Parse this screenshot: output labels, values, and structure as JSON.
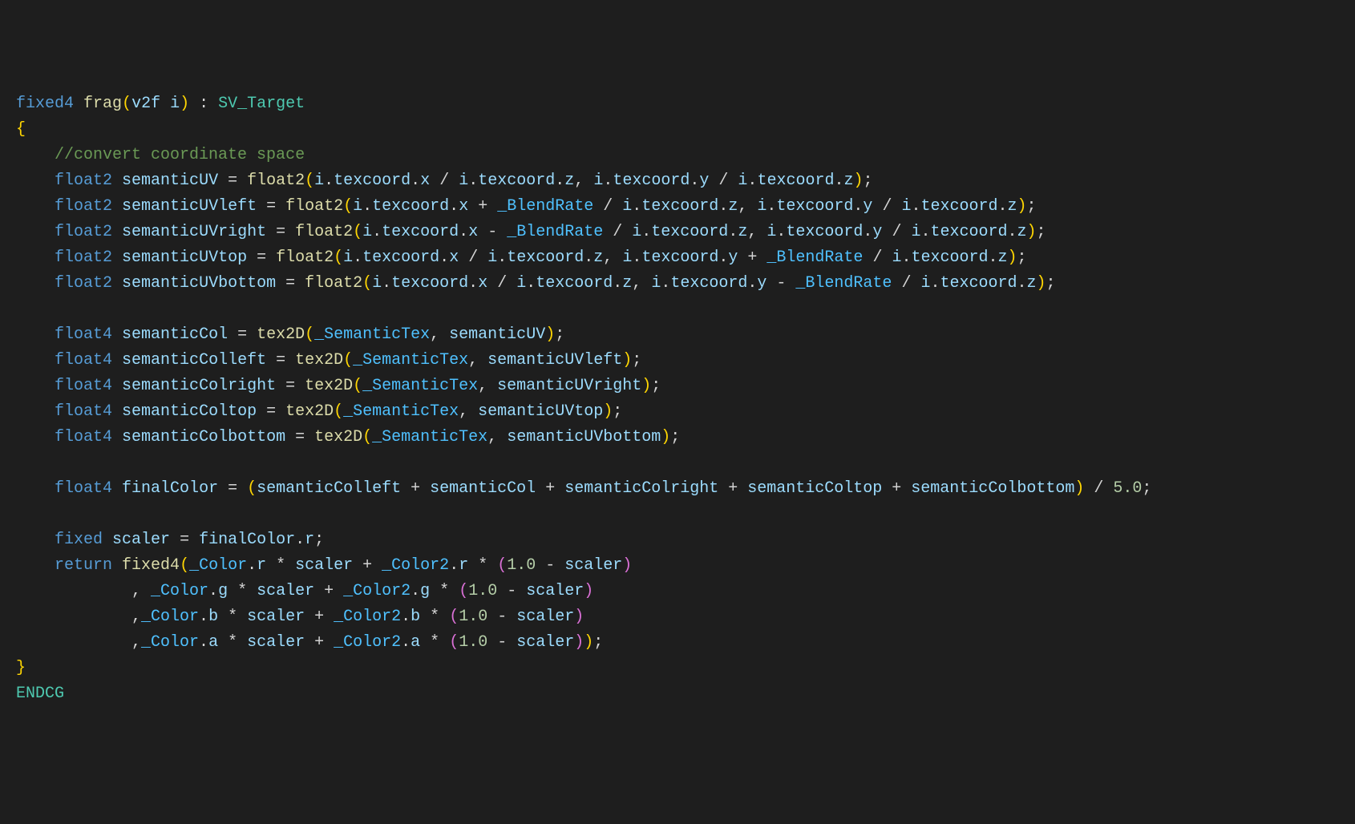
{
  "tokens": [
    [
      [
        "kw",
        "fixed4"
      ],
      [
        "pnc",
        " "
      ],
      [
        "fn",
        "frag"
      ],
      [
        "brk",
        "("
      ],
      [
        "id",
        "v2f"
      ],
      [
        "pnc",
        " "
      ],
      [
        "id",
        "i"
      ],
      [
        "brk",
        ")"
      ],
      [
        "pnc",
        " : "
      ],
      [
        "str",
        "SV_Target"
      ]
    ],
    [
      [
        "brk",
        "{"
      ]
    ],
    [
      [
        "pnc",
        "    "
      ],
      [
        "cmt",
        "//convert coordinate space"
      ]
    ],
    [
      [
        "pnc",
        "    "
      ],
      [
        "kw",
        "float2"
      ],
      [
        "pnc",
        " "
      ],
      [
        "id",
        "semanticUV"
      ],
      [
        "pnc",
        " = "
      ],
      [
        "fn",
        "float2"
      ],
      [
        "brk",
        "("
      ],
      [
        "id",
        "i"
      ],
      [
        "pnc",
        "."
      ],
      [
        "id",
        "texcoord"
      ],
      [
        "pnc",
        "."
      ],
      [
        "id",
        "x"
      ],
      [
        "pnc",
        " / "
      ],
      [
        "id",
        "i"
      ],
      [
        "pnc",
        "."
      ],
      [
        "id",
        "texcoord"
      ],
      [
        "pnc",
        "."
      ],
      [
        "id",
        "z"
      ],
      [
        "pnc",
        ", "
      ],
      [
        "id",
        "i"
      ],
      [
        "pnc",
        "."
      ],
      [
        "id",
        "texcoord"
      ],
      [
        "pnc",
        "."
      ],
      [
        "id",
        "y"
      ],
      [
        "pnc",
        " / "
      ],
      [
        "id",
        "i"
      ],
      [
        "pnc",
        "."
      ],
      [
        "id",
        "texcoord"
      ],
      [
        "pnc",
        "."
      ],
      [
        "id",
        "z"
      ],
      [
        "brk",
        ")"
      ],
      [
        "pnc",
        ";"
      ]
    ],
    [
      [
        "pnc",
        "    "
      ],
      [
        "kw",
        "float2"
      ],
      [
        "pnc",
        " "
      ],
      [
        "id",
        "semanticUVleft"
      ],
      [
        "pnc",
        " = "
      ],
      [
        "fn",
        "float2"
      ],
      [
        "brk",
        "("
      ],
      [
        "id",
        "i"
      ],
      [
        "pnc",
        "."
      ],
      [
        "id",
        "texcoord"
      ],
      [
        "pnc",
        "."
      ],
      [
        "id",
        "x"
      ],
      [
        "pnc",
        " + "
      ],
      [
        "enm",
        "_BlendRate"
      ],
      [
        "pnc",
        " / "
      ],
      [
        "id",
        "i"
      ],
      [
        "pnc",
        "."
      ],
      [
        "id",
        "texcoord"
      ],
      [
        "pnc",
        "."
      ],
      [
        "id",
        "z"
      ],
      [
        "pnc",
        ", "
      ],
      [
        "id",
        "i"
      ],
      [
        "pnc",
        "."
      ],
      [
        "id",
        "texcoord"
      ],
      [
        "pnc",
        "."
      ],
      [
        "id",
        "y"
      ],
      [
        "pnc",
        " / "
      ],
      [
        "id",
        "i"
      ],
      [
        "pnc",
        "."
      ],
      [
        "id",
        "texcoord"
      ],
      [
        "pnc",
        "."
      ],
      [
        "id",
        "z"
      ],
      [
        "brk",
        ")"
      ],
      [
        "pnc",
        ";"
      ]
    ],
    [
      [
        "pnc",
        "    "
      ],
      [
        "kw",
        "float2"
      ],
      [
        "pnc",
        " "
      ],
      [
        "id",
        "semanticUVright"
      ],
      [
        "pnc",
        " = "
      ],
      [
        "fn",
        "float2"
      ],
      [
        "brk",
        "("
      ],
      [
        "id",
        "i"
      ],
      [
        "pnc",
        "."
      ],
      [
        "id",
        "texcoord"
      ],
      [
        "pnc",
        "."
      ],
      [
        "id",
        "x"
      ],
      [
        "pnc",
        " - "
      ],
      [
        "enm",
        "_BlendRate"
      ],
      [
        "pnc",
        " / "
      ],
      [
        "id",
        "i"
      ],
      [
        "pnc",
        "."
      ],
      [
        "id",
        "texcoord"
      ],
      [
        "pnc",
        "."
      ],
      [
        "id",
        "z"
      ],
      [
        "pnc",
        ", "
      ],
      [
        "id",
        "i"
      ],
      [
        "pnc",
        "."
      ],
      [
        "id",
        "texcoord"
      ],
      [
        "pnc",
        "."
      ],
      [
        "id",
        "y"
      ],
      [
        "pnc",
        " / "
      ],
      [
        "id",
        "i"
      ],
      [
        "pnc",
        "."
      ],
      [
        "id",
        "texcoord"
      ],
      [
        "pnc",
        "."
      ],
      [
        "id",
        "z"
      ],
      [
        "brk",
        ")"
      ],
      [
        "pnc",
        ";"
      ]
    ],
    [
      [
        "pnc",
        "    "
      ],
      [
        "kw",
        "float2"
      ],
      [
        "pnc",
        " "
      ],
      [
        "id",
        "semanticUVtop"
      ],
      [
        "pnc",
        " = "
      ],
      [
        "fn",
        "float2"
      ],
      [
        "brk",
        "("
      ],
      [
        "id",
        "i"
      ],
      [
        "pnc",
        "."
      ],
      [
        "id",
        "texcoord"
      ],
      [
        "pnc",
        "."
      ],
      [
        "id",
        "x"
      ],
      [
        "pnc",
        " / "
      ],
      [
        "id",
        "i"
      ],
      [
        "pnc",
        "."
      ],
      [
        "id",
        "texcoord"
      ],
      [
        "pnc",
        "."
      ],
      [
        "id",
        "z"
      ],
      [
        "pnc",
        ", "
      ],
      [
        "id",
        "i"
      ],
      [
        "pnc",
        "."
      ],
      [
        "id",
        "texcoord"
      ],
      [
        "pnc",
        "."
      ],
      [
        "id",
        "y"
      ],
      [
        "pnc",
        " + "
      ],
      [
        "enm",
        "_BlendRate"
      ],
      [
        "pnc",
        " / "
      ],
      [
        "id",
        "i"
      ],
      [
        "pnc",
        "."
      ],
      [
        "id",
        "texcoord"
      ],
      [
        "pnc",
        "."
      ],
      [
        "id",
        "z"
      ],
      [
        "brk",
        ")"
      ],
      [
        "pnc",
        ";"
      ]
    ],
    [
      [
        "pnc",
        "    "
      ],
      [
        "kw",
        "float2"
      ],
      [
        "pnc",
        " "
      ],
      [
        "id",
        "semanticUVbottom"
      ],
      [
        "pnc",
        " = "
      ],
      [
        "fn",
        "float2"
      ],
      [
        "brk",
        "("
      ],
      [
        "id",
        "i"
      ],
      [
        "pnc",
        "."
      ],
      [
        "id",
        "texcoord"
      ],
      [
        "pnc",
        "."
      ],
      [
        "id",
        "x"
      ],
      [
        "pnc",
        " / "
      ],
      [
        "id",
        "i"
      ],
      [
        "pnc",
        "."
      ],
      [
        "id",
        "texcoord"
      ],
      [
        "pnc",
        "."
      ],
      [
        "id",
        "z"
      ],
      [
        "pnc",
        ", "
      ],
      [
        "id",
        "i"
      ],
      [
        "pnc",
        "."
      ],
      [
        "id",
        "texcoord"
      ],
      [
        "pnc",
        "."
      ],
      [
        "id",
        "y"
      ],
      [
        "pnc",
        " - "
      ],
      [
        "enm",
        "_BlendRate"
      ],
      [
        "pnc",
        " / "
      ],
      [
        "id",
        "i"
      ],
      [
        "pnc",
        "."
      ],
      [
        "id",
        "texcoord"
      ],
      [
        "pnc",
        "."
      ],
      [
        "id",
        "z"
      ],
      [
        "brk",
        ")"
      ],
      [
        "pnc",
        ";"
      ]
    ],
    [
      [
        "pnc",
        ""
      ]
    ],
    [
      [
        "pnc",
        "    "
      ],
      [
        "kw",
        "float4"
      ],
      [
        "pnc",
        " "
      ],
      [
        "id",
        "semanticCol"
      ],
      [
        "pnc",
        " = "
      ],
      [
        "fn",
        "tex2D"
      ],
      [
        "brk",
        "("
      ],
      [
        "enm",
        "_SemanticTex"
      ],
      [
        "pnc",
        ", "
      ],
      [
        "id",
        "semanticUV"
      ],
      [
        "brk",
        ")"
      ],
      [
        "pnc",
        ";"
      ]
    ],
    [
      [
        "pnc",
        "    "
      ],
      [
        "kw",
        "float4"
      ],
      [
        "pnc",
        " "
      ],
      [
        "id",
        "semanticColleft"
      ],
      [
        "pnc",
        " = "
      ],
      [
        "fn",
        "tex2D"
      ],
      [
        "brk",
        "("
      ],
      [
        "enm",
        "_SemanticTex"
      ],
      [
        "pnc",
        ", "
      ],
      [
        "id",
        "semanticUVleft"
      ],
      [
        "brk",
        ")"
      ],
      [
        "pnc",
        ";"
      ]
    ],
    [
      [
        "pnc",
        "    "
      ],
      [
        "kw",
        "float4"
      ],
      [
        "pnc",
        " "
      ],
      [
        "id",
        "semanticColright"
      ],
      [
        "pnc",
        " = "
      ],
      [
        "fn",
        "tex2D"
      ],
      [
        "brk",
        "("
      ],
      [
        "enm",
        "_SemanticTex"
      ],
      [
        "pnc",
        ", "
      ],
      [
        "id",
        "semanticUVright"
      ],
      [
        "brk",
        ")"
      ],
      [
        "pnc",
        ";"
      ]
    ],
    [
      [
        "pnc",
        "    "
      ],
      [
        "kw",
        "float4"
      ],
      [
        "pnc",
        " "
      ],
      [
        "id",
        "semanticColtop"
      ],
      [
        "pnc",
        " = "
      ],
      [
        "fn",
        "tex2D"
      ],
      [
        "brk",
        "("
      ],
      [
        "enm",
        "_SemanticTex"
      ],
      [
        "pnc",
        ", "
      ],
      [
        "id",
        "semanticUVtop"
      ],
      [
        "brk",
        ")"
      ],
      [
        "pnc",
        ";"
      ]
    ],
    [
      [
        "pnc",
        "    "
      ],
      [
        "kw",
        "float4"
      ],
      [
        "pnc",
        " "
      ],
      [
        "id",
        "semanticColbottom"
      ],
      [
        "pnc",
        " = "
      ],
      [
        "fn",
        "tex2D"
      ],
      [
        "brk",
        "("
      ],
      [
        "enm",
        "_SemanticTex"
      ],
      [
        "pnc",
        ", "
      ],
      [
        "id",
        "semanticUVbottom"
      ],
      [
        "brk",
        ")"
      ],
      [
        "pnc",
        ";"
      ]
    ],
    [
      [
        "pnc",
        ""
      ]
    ],
    [
      [
        "pnc",
        "    "
      ],
      [
        "kw",
        "float4"
      ],
      [
        "pnc",
        " "
      ],
      [
        "id",
        "finalColor"
      ],
      [
        "pnc",
        " = "
      ],
      [
        "brk",
        "("
      ],
      [
        "id",
        "semanticColleft"
      ],
      [
        "pnc",
        " + "
      ],
      [
        "id",
        "semanticCol"
      ],
      [
        "pnc",
        " + "
      ],
      [
        "id",
        "semanticColright"
      ],
      [
        "pnc",
        " + "
      ],
      [
        "id",
        "semanticColtop"
      ],
      [
        "pnc",
        " + "
      ],
      [
        "id",
        "semanticColbottom"
      ],
      [
        "brk",
        ")"
      ],
      [
        "pnc",
        " / "
      ],
      [
        "num",
        "5.0"
      ],
      [
        "pnc",
        ";"
      ]
    ],
    [
      [
        "pnc",
        ""
      ]
    ],
    [
      [
        "pnc",
        "    "
      ],
      [
        "kw",
        "fixed"
      ],
      [
        "pnc",
        " "
      ],
      [
        "id",
        "scaler"
      ],
      [
        "pnc",
        " = "
      ],
      [
        "id",
        "finalColor"
      ],
      [
        "pnc",
        "."
      ],
      [
        "id",
        "r"
      ],
      [
        "pnc",
        ";"
      ]
    ],
    [
      [
        "pnc",
        "    "
      ],
      [
        "kw",
        "return"
      ],
      [
        "pnc",
        " "
      ],
      [
        "fn",
        "fixed4"
      ],
      [
        "brk",
        "("
      ],
      [
        "enm",
        "_Color"
      ],
      [
        "pnc",
        "."
      ],
      [
        "id",
        "r"
      ],
      [
        "pnc",
        " * "
      ],
      [
        "id",
        "scaler"
      ],
      [
        "pnc",
        " + "
      ],
      [
        "enm",
        "_Color2"
      ],
      [
        "pnc",
        "."
      ],
      [
        "id",
        "r"
      ],
      [
        "pnc",
        " * "
      ],
      [
        "pk",
        "("
      ],
      [
        "num",
        "1.0"
      ],
      [
        "pnc",
        " - "
      ],
      [
        "id",
        "scaler"
      ],
      [
        "pk",
        ")"
      ]
    ],
    [
      [
        "pnc",
        "            , "
      ],
      [
        "enm",
        "_Color"
      ],
      [
        "pnc",
        "."
      ],
      [
        "id",
        "g"
      ],
      [
        "pnc",
        " * "
      ],
      [
        "id",
        "scaler"
      ],
      [
        "pnc",
        " + "
      ],
      [
        "enm",
        "_Color2"
      ],
      [
        "pnc",
        "."
      ],
      [
        "id",
        "g"
      ],
      [
        "pnc",
        " * "
      ],
      [
        "pk",
        "("
      ],
      [
        "num",
        "1.0"
      ],
      [
        "pnc",
        " - "
      ],
      [
        "id",
        "scaler"
      ],
      [
        "pk",
        ")"
      ]
    ],
    [
      [
        "pnc",
        "            ,"
      ],
      [
        "enm",
        "_Color"
      ],
      [
        "pnc",
        "."
      ],
      [
        "id",
        "b"
      ],
      [
        "pnc",
        " * "
      ],
      [
        "id",
        "scaler"
      ],
      [
        "pnc",
        " + "
      ],
      [
        "enm",
        "_Color2"
      ],
      [
        "pnc",
        "."
      ],
      [
        "id",
        "b"
      ],
      [
        "pnc",
        " * "
      ],
      [
        "pk",
        "("
      ],
      [
        "num",
        "1.0"
      ],
      [
        "pnc",
        " - "
      ],
      [
        "id",
        "scaler"
      ],
      [
        "pk",
        ")"
      ]
    ],
    [
      [
        "pnc",
        "            ,"
      ],
      [
        "enm",
        "_Color"
      ],
      [
        "pnc",
        "."
      ],
      [
        "id",
        "a"
      ],
      [
        "pnc",
        " * "
      ],
      [
        "id",
        "scaler"
      ],
      [
        "pnc",
        " + "
      ],
      [
        "enm",
        "_Color2"
      ],
      [
        "pnc",
        "."
      ],
      [
        "id",
        "a"
      ],
      [
        "pnc",
        " * "
      ],
      [
        "pk",
        "("
      ],
      [
        "num",
        "1.0"
      ],
      [
        "pnc",
        " - "
      ],
      [
        "id",
        "scaler"
      ],
      [
        "pk",
        ")"
      ],
      [
        "brk",
        ")"
      ],
      [
        "pnc",
        ";"
      ]
    ],
    [
      [
        "brk",
        "}"
      ]
    ],
    [
      [
        "str",
        "ENDCG"
      ]
    ]
  ]
}
